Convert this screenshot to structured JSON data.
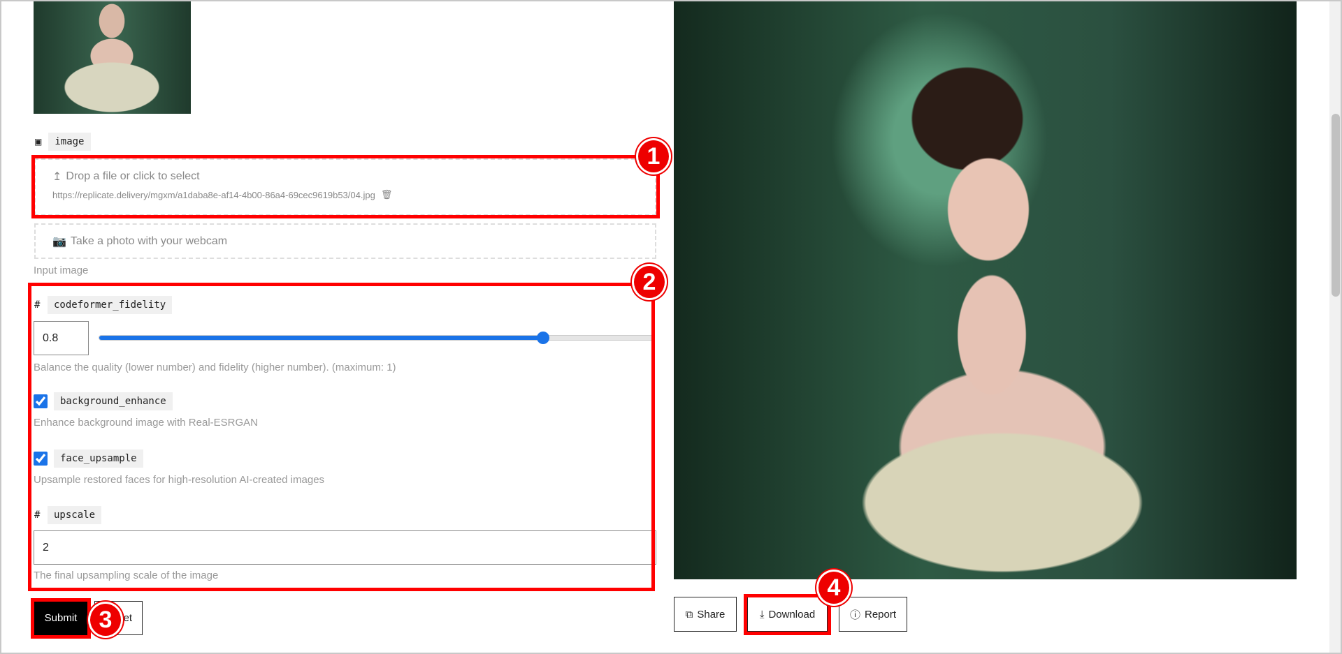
{
  "input_image_param": {
    "icon": "image-icon",
    "name": "image",
    "dropzone_text": "Drop a file or click to select",
    "file_url": "https://replicate.delivery/mgxm/a1daba8e-af14-4b00-86a4-69cec9619b53/04.jpg",
    "webcam_text": "Take a photo with your webcam",
    "description": "Input image"
  },
  "codeformer_fidelity": {
    "icon": "#",
    "name": "codeformer_fidelity",
    "value": "0.8",
    "slider_fraction": 0.8,
    "description": "Balance the quality (lower number) and fidelity (higher number). (maximum: 1)"
  },
  "background_enhance": {
    "name": "background_enhance",
    "checked": true,
    "description": "Enhance background image with Real-ESRGAN"
  },
  "face_upsample": {
    "name": "face_upsample",
    "checked": true,
    "description": "Upsample restored faces for high-resolution AI-created images"
  },
  "upscale": {
    "icon": "#",
    "name": "upscale",
    "value": "2",
    "description": "The final upsampling scale of the image"
  },
  "form_buttons": {
    "submit": "Submit",
    "reset": "Reset"
  },
  "output_buttons": {
    "share": "Share",
    "download": "Download",
    "report": "Report"
  },
  "annotations": [
    "1",
    "2",
    "3",
    "4"
  ],
  "colors": {
    "accent": "#1a73e8",
    "annotation": "#ff0000"
  }
}
